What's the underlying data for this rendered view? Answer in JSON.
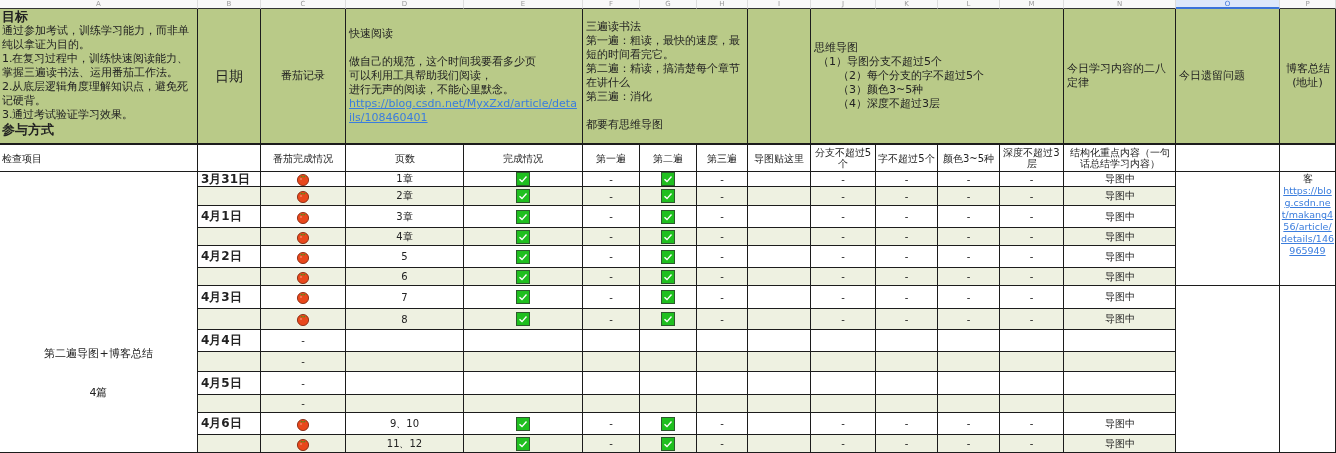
{
  "column_letters": [
    {
      "label": "A",
      "selected": false
    },
    {
      "label": "B",
      "selected": false
    },
    {
      "label": "C",
      "selected": false
    },
    {
      "label": "D",
      "selected": false
    },
    {
      "label": "E",
      "selected": false
    },
    {
      "label": "F",
      "selected": false
    },
    {
      "label": "G",
      "selected": false
    },
    {
      "label": "H",
      "selected": false
    },
    {
      "label": "I",
      "selected": false
    },
    {
      "label": "J",
      "selected": false
    },
    {
      "label": "K",
      "selected": false
    },
    {
      "label": "L",
      "selected": false
    },
    {
      "label": "M",
      "selected": false
    },
    {
      "label": "N",
      "selected": false
    },
    {
      "label": "O",
      "selected": true
    },
    {
      "label": "P",
      "selected": false
    }
  ],
  "header": {
    "goal": {
      "title": "目标",
      "lines": [
        "通过参加考试，训练学习能力，而非单纯以拿证为目的。",
        "1.在复习过程中，训练快速阅读能力、掌握三遍读书法、运用番茄工作法。",
        "2.从底层逻辑角度理解知识点，避免死记硬背。",
        "3.通过考试验证学习效果。"
      ],
      "subtitle": "参与方式"
    },
    "date_label": "日期",
    "pomodoro_label": "番茄记录",
    "fast_reading": {
      "title": "快速阅读",
      "lines": [
        "做自己的规范，这个时间我要看多少页",
        "可以利用工具帮助我们阅读，",
        "进行无声的阅读，不能心里默念。"
      ],
      "link": "https://blog.csdn.net/MyxZxd/article/details/108460401"
    },
    "three_pass": {
      "lines": [
        "三遍读书法",
        "第一遍：粗读，最快的速度，最短的时间看完它。",
        "第二遍：精读，搞清楚每个章节在讲什么",
        "第三遍：消化"
      ],
      "footer": "都要有思维导图"
    },
    "mind_map": {
      "title": "思维导图",
      "lines": [
        "（1）导图分支不超过5个",
        "（2）每个分支的字不超过5个",
        "（3）颜色3~5种",
        "（4）深度不超过3层"
      ]
    },
    "pareto": "今日学习内容的二八定律",
    "open_issues": "今日遗留问题",
    "blog_summary": [
      "博客总结",
      "(地址)"
    ]
  },
  "check_items": [
    "检查项目",
    "番茄完成情况",
    "页数",
    "完成情况",
    "第一遍",
    "第二遍",
    "第三遍",
    "导图贴这里",
    "分支不超过5个",
    "字不超过5个",
    "颜色3~5种",
    "深度不超过3层",
    "结构化重点内容（一句话总结学习内容）"
  ],
  "plan": [
    "第二遍导图+博客总结",
    "4篇"
  ],
  "blog": {
    "prefix": "客",
    "link": "https://blog.csdn.net/makang456/article/details/146965949"
  },
  "rows": [
    {
      "date": "3月31日",
      "pomodoro": {
        "kind": "icon"
      },
      "pages": "1章",
      "done": true,
      "pass_1": "-",
      "pass_2_done": true,
      "pass_3": "-",
      "branches": "-",
      "words": "-",
      "colors": "-",
      "depth": "-",
      "summary": "导图中"
    },
    {
      "pomodoro": {
        "kind": "icon"
      },
      "pages": "2章",
      "done": true,
      "pass_1": "-",
      "pass_2_done": true,
      "pass_3": "-",
      "branches": "-",
      "words": "-",
      "colors": "-",
      "depth": "-",
      "summary": "导图中"
    },
    {
      "date": "4月1日",
      "pomodoro": {
        "kind": "icon"
      },
      "pages": "3章",
      "done": true,
      "pass_1": "-",
      "pass_2_done": true,
      "pass_3": "-",
      "branches": "-",
      "words": "-",
      "colors": "-",
      "depth": "-",
      "summary": "导图中"
    },
    {
      "pomodoro": {
        "kind": "icon"
      },
      "pages": "4章",
      "done": true,
      "pass_1": "-",
      "pass_2_done": true,
      "pass_3": "-",
      "branches": "-",
      "words": "-",
      "colors": "-",
      "depth": "-",
      "summary": "导图中"
    },
    {
      "date": "4月2日",
      "pomodoro": {
        "kind": "icon"
      },
      "pages": "5",
      "done": true,
      "pass_1": "-",
      "pass_2_done": true,
      "pass_3": "-",
      "branches": "-",
      "words": "-",
      "colors": "-",
      "depth": "-",
      "summary": "导图中"
    },
    {
      "pomodoro": {
        "kind": "icon"
      },
      "pages": "6",
      "done": true,
      "pass_1": "-",
      "pass_2_done": true,
      "pass_3": "-",
      "branches": "-",
      "words": "-",
      "colors": "-",
      "depth": "-",
      "summary": "导图中"
    },
    {
      "date": "4月3日",
      "pomodoro": {
        "kind": "icon"
      },
      "pages": "7",
      "done": true,
      "pass_1": "-",
      "pass_2_done": true,
      "pass_3": "-",
      "branches": "-",
      "words": "-",
      "colors": "-",
      "depth": "-",
      "summary": "导图中"
    },
    {
      "pomodoro": {
        "kind": "icon"
      },
      "pages": "8",
      "done": true,
      "pass_1": "-",
      "pass_2_done": true,
      "pass_3": "-",
      "branches": "-",
      "words": "-",
      "colors": "-",
      "depth": "-",
      "summary": "导图中"
    },
    {
      "date": "4月4日",
      "pomodoro": {
        "kind": "text",
        "text": "-"
      },
      "done": false,
      "pass_2_done": false
    },
    {
      "pomodoro": {
        "kind": "text",
        "text": "-"
      },
      "done": false,
      "pass_2_done": false
    },
    {
      "date": "4月5日",
      "pomodoro": {
        "kind": "text",
        "text": "-"
      },
      "done": false,
      "pass_2_done": false
    },
    {
      "pomodoro": {
        "kind": "text",
        "text": "-"
      },
      "done": false,
      "pass_2_done": false
    },
    {
      "date": "4月6日",
      "pomodoro": {
        "kind": "icon"
      },
      "pages": "9、10",
      "done": true,
      "pass_1": "-",
      "pass_2_done": true,
      "pass_3": "-",
      "branches": "-",
      "words": "-",
      "colors": "-",
      "depth": "-",
      "summary": "导图中"
    },
    {
      "pomodoro": {
        "kind": "icon"
      },
      "pages": "11、12",
      "done": true,
      "pass_1": "-",
      "pass_2_done": true,
      "pass_3": "-",
      "branches": "-",
      "words": "-",
      "colors": "-",
      "depth": "-",
      "summary": "导图中"
    }
  ]
}
